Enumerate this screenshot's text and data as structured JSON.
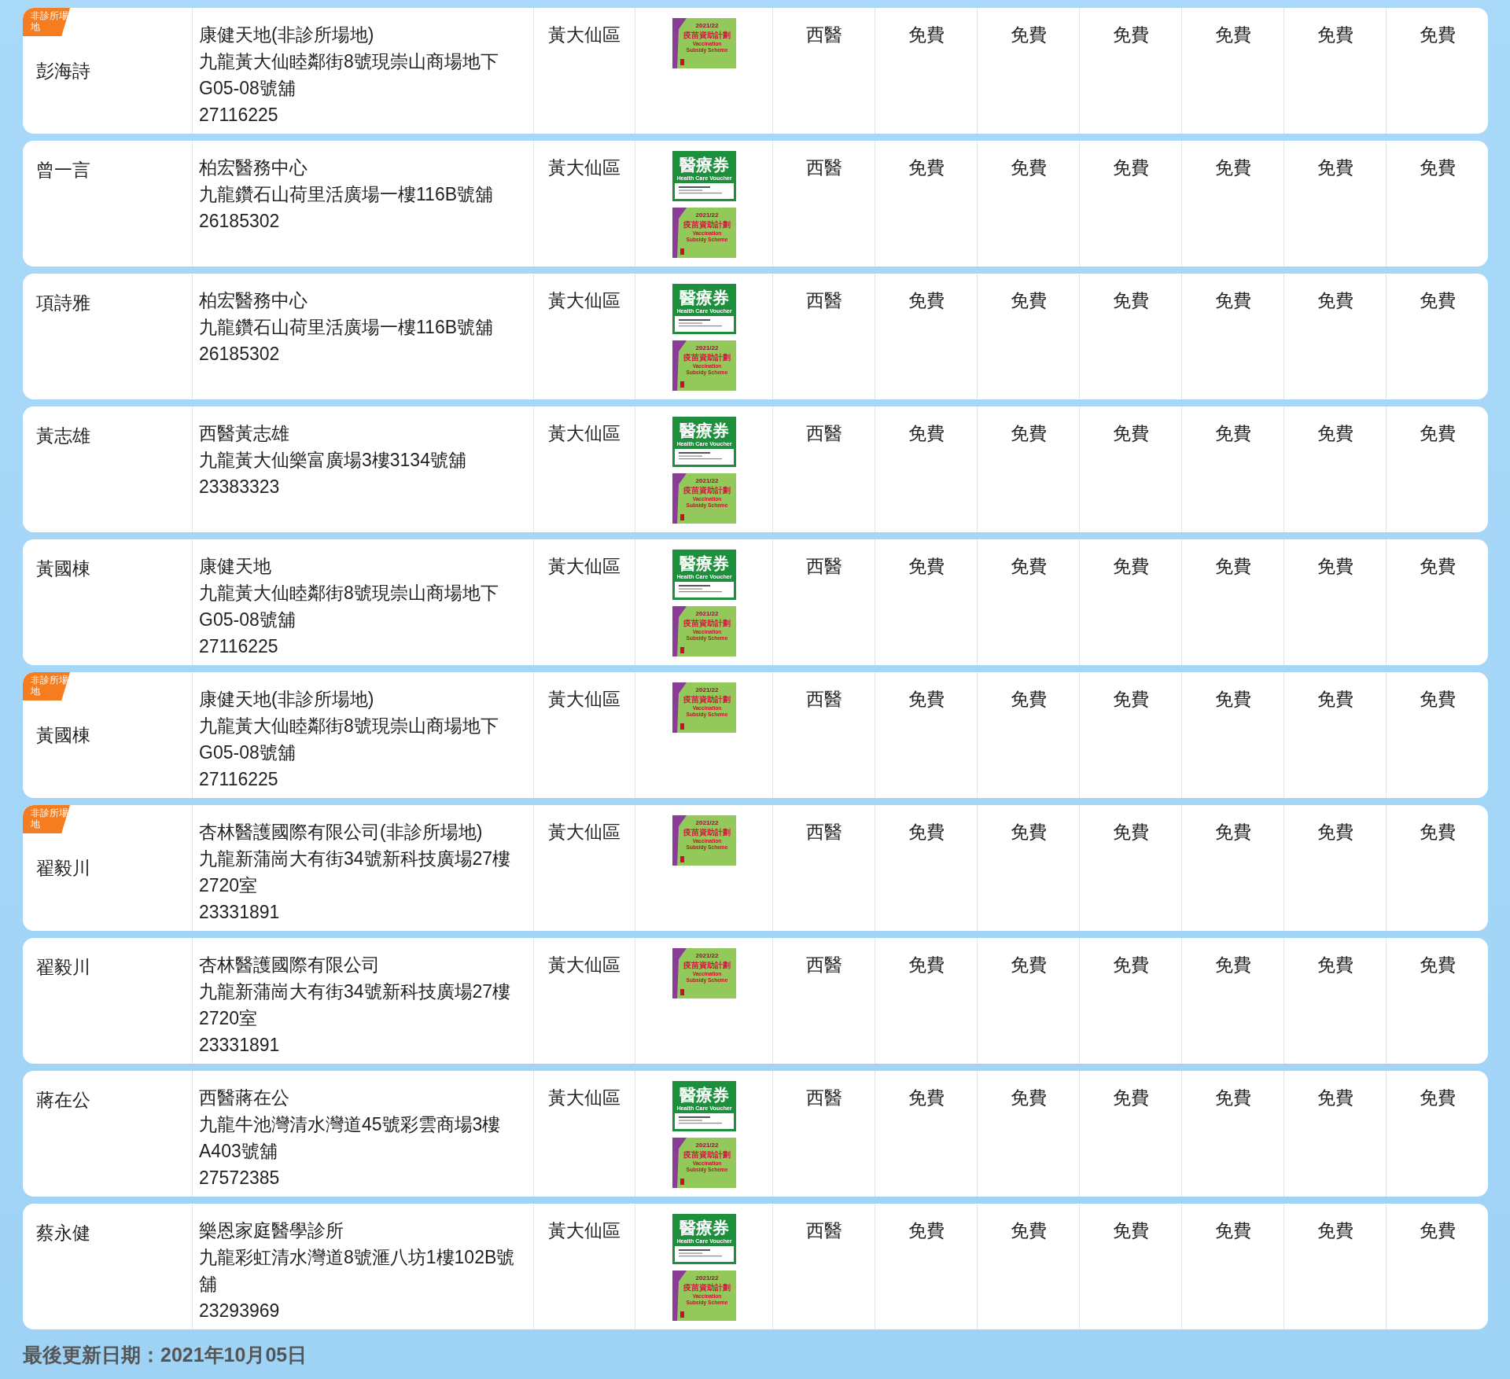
{
  "rows": [
    {
      "doctor": "彭海詩",
      "badge": "非診所場地",
      "clinic": "康健天地(非診所場地)",
      "address_lines": [
        "九龍黃大仙睦鄰街8號現崇山商場地下",
        "G05-08號舖"
      ],
      "phone": "27116225",
      "district": "黃大仙區",
      "schemes": [
        {
          "kind": "vss",
          "year": "2021/22",
          "title": "疫苗資助計劃",
          "subtitle": "Vaccination Subsidy Scheme"
        }
      ],
      "service": "西醫",
      "fees": [
        "免費",
        "免費",
        "免費",
        "免費",
        "免費",
        "免費"
      ]
    },
    {
      "doctor": "曾一言",
      "clinic": "柏宏醫務中心",
      "address_lines": [
        "九龍鑽石山荷里活廣場一樓116B號舖"
      ],
      "phone": "26185302",
      "district": "黃大仙區",
      "schemes": [
        {
          "kind": "hcv",
          "title": "醫療券",
          "subtitle": "Health Care Voucher"
        },
        {
          "kind": "vss",
          "year": "2021/22",
          "title": "疫苗資助計劃",
          "subtitle": "Vaccination Subsidy Scheme"
        }
      ],
      "service": "西醫",
      "fees": [
        "免費",
        "免費",
        "免費",
        "免費",
        "免費",
        "免費"
      ]
    },
    {
      "doctor": "項詩雅",
      "clinic": "柏宏醫務中心",
      "address_lines": [
        "九龍鑽石山荷里活廣場一樓116B號舖"
      ],
      "phone": "26185302",
      "district": "黃大仙區",
      "schemes": [
        {
          "kind": "hcv",
          "title": "醫療券",
          "subtitle": "Health Care Voucher"
        },
        {
          "kind": "vss",
          "year": "2021/22",
          "title": "疫苗資助計劃",
          "subtitle": "Vaccination Subsidy Scheme"
        }
      ],
      "service": "西醫",
      "fees": [
        "免費",
        "免費",
        "免費",
        "免費",
        "免費",
        "免費"
      ]
    },
    {
      "doctor": "黃志雄",
      "clinic": "西醫黃志雄",
      "address_lines": [
        "九龍黃大仙樂富廣場3樓3134號舖"
      ],
      "phone": "23383323",
      "district": "黃大仙區",
      "schemes": [
        {
          "kind": "hcv",
          "title": "醫療券",
          "subtitle": "Health Care Voucher"
        },
        {
          "kind": "vss",
          "year": "2021/22",
          "title": "疫苗資助計劃",
          "subtitle": "Vaccination Subsidy Scheme"
        }
      ],
      "service": "西醫",
      "fees": [
        "免費",
        "免費",
        "免費",
        "免費",
        "免費",
        "免費"
      ]
    },
    {
      "doctor": "黃國棟",
      "clinic": "康健天地",
      "address_lines": [
        "九龍黃大仙睦鄰街8號現崇山商場地下",
        "G05-08號舖"
      ],
      "phone": "27116225",
      "district": "黃大仙區",
      "schemes": [
        {
          "kind": "hcv",
          "title": "醫療券",
          "subtitle": "Health Care Voucher"
        },
        {
          "kind": "vss",
          "year": "2021/22",
          "title": "疫苗資助計劃",
          "subtitle": "Vaccination Subsidy Scheme"
        }
      ],
      "service": "西醫",
      "fees": [
        "免費",
        "免費",
        "免費",
        "免費",
        "免費",
        "免費"
      ]
    },
    {
      "doctor": "黃國棟",
      "badge": "非診所場地",
      "clinic": "康健天地(非診所場地)",
      "address_lines": [
        "九龍黃大仙睦鄰街8號現崇山商場地下",
        "G05-08號舖"
      ],
      "phone": "27116225",
      "district": "黃大仙區",
      "schemes": [
        {
          "kind": "vss",
          "year": "2021/22",
          "title": "疫苗資助計劃",
          "subtitle": "Vaccination Subsidy Scheme"
        }
      ],
      "service": "西醫",
      "fees": [
        "免費",
        "免費",
        "免費",
        "免費",
        "免費",
        "免費"
      ]
    },
    {
      "doctor": "翟毅川",
      "badge": "非診所場地",
      "clinic": "杏林醫護國際有限公司(非診所場地)",
      "address_lines": [
        "九龍新蒲崗大有街34號新科技廣場27樓",
        "2720室"
      ],
      "phone": "23331891",
      "district": "黃大仙區",
      "schemes": [
        {
          "kind": "vss",
          "year": "2021/22",
          "title": "疫苗資助計劃",
          "subtitle": "Vaccination Subsidy Scheme"
        }
      ],
      "service": "西醫",
      "fees": [
        "免費",
        "免費",
        "免費",
        "免費",
        "免費",
        "免費"
      ]
    },
    {
      "doctor": "翟毅川",
      "clinic": "杏林醫護國際有限公司",
      "address_lines": [
        "九龍新蒲崗大有街34號新科技廣場27樓",
        "2720室"
      ],
      "phone": "23331891",
      "district": "黃大仙區",
      "schemes": [
        {
          "kind": "vss",
          "year": "2021/22",
          "title": "疫苗資助計劃",
          "subtitle": "Vaccination Subsidy Scheme"
        }
      ],
      "service": "西醫",
      "fees": [
        "免費",
        "免費",
        "免費",
        "免費",
        "免費",
        "免費"
      ]
    },
    {
      "doctor": "蔣在公",
      "clinic": "西醫蔣在公",
      "address_lines": [
        "九龍牛池灣清水灣道45號彩雲商場3樓",
        "A403號舖"
      ],
      "phone": "27572385",
      "district": "黃大仙區",
      "schemes": [
        {
          "kind": "hcv",
          "title": "醫療券",
          "subtitle": "Health Care Voucher"
        },
        {
          "kind": "vss",
          "year": "2021/22",
          "title": "疫苗資助計劃",
          "subtitle": "Vaccination Subsidy Scheme"
        }
      ],
      "service": "西醫",
      "fees": [
        "免費",
        "免費",
        "免費",
        "免費",
        "免費",
        "免費"
      ]
    },
    {
      "doctor": "蔡永健",
      "clinic": "樂恩家庭醫學診所",
      "address_lines": [
        "九龍彩虹清水灣道8號滙八坊1樓102B號",
        "舖"
      ],
      "phone": "23293969",
      "district": "黃大仙區",
      "schemes": [
        {
          "kind": "hcv",
          "title": "醫療券",
          "subtitle": "Health Care Voucher"
        },
        {
          "kind": "vss",
          "year": "2021/22",
          "title": "疫苗資助計劃",
          "subtitle": "Vaccination Subsidy Scheme"
        }
      ],
      "service": "西醫",
      "fees": [
        "免費",
        "免費",
        "免費",
        "免費",
        "免費",
        "免費"
      ]
    }
  ],
  "footer": "最後更新日期：2021年10月05日"
}
